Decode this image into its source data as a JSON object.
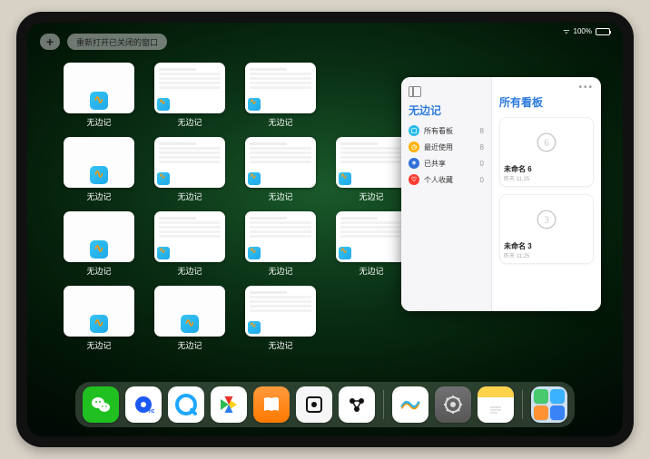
{
  "statusbar": {
    "signal": "wifi",
    "battery_text": "100%"
  },
  "topbar": {
    "plus_label": "+",
    "reopen_label": "重新打开已关闭的窗口"
  },
  "switcher": {
    "app_label": "无边记",
    "cards": [
      {
        "kind": "white"
      },
      {
        "kind": "cal"
      },
      {
        "kind": "cal"
      },
      {
        "kind": "white"
      },
      {
        "kind": "cal"
      },
      {
        "kind": "cal"
      },
      {
        "kind": "cal"
      },
      {
        "kind": "white"
      },
      {
        "kind": "cal"
      },
      {
        "kind": "cal"
      },
      {
        "kind": "cal"
      },
      {
        "kind": "white"
      },
      {
        "kind": "white"
      },
      {
        "kind": "cal"
      }
    ]
  },
  "freeform": {
    "sidebar_title": "无边记",
    "items": [
      {
        "icon": "c1",
        "glyph": "▢",
        "label": "所有看板",
        "count": "8"
      },
      {
        "icon": "c2",
        "glyph": "◷",
        "label": "最近使用",
        "count": "8"
      },
      {
        "icon": "c3",
        "glyph": "✶",
        "label": "已共享",
        "count": "0"
      },
      {
        "icon": "c4",
        "glyph": "♡",
        "label": "个人收藏",
        "count": "0"
      }
    ],
    "main_title": "所有看板",
    "boards": [
      {
        "digit": "6",
        "name": "未命名 6",
        "time": "昨天 11:25"
      },
      {
        "digit": "3",
        "name": "未命名 3",
        "time": "昨天 11:25"
      }
    ]
  },
  "dock": {
    "apps": [
      {
        "name": "wechat",
        "label": "WeChat"
      },
      {
        "name": "qhd",
        "label": "Quark HD"
      },
      {
        "name": "qbrowser",
        "label": "QQ Browser"
      },
      {
        "name": "yingshi",
        "label": "央视影音"
      },
      {
        "name": "books",
        "label": "Books"
      },
      {
        "name": "obs",
        "label": "Obsidian"
      },
      {
        "name": "wan",
        "label": "万兴"
      },
      {
        "name": "freeform",
        "label": "Freeform"
      },
      {
        "name": "settings",
        "label": "Settings"
      },
      {
        "name": "notes",
        "label": "Notes"
      },
      {
        "name": "multi",
        "label": "App Library"
      }
    ]
  }
}
